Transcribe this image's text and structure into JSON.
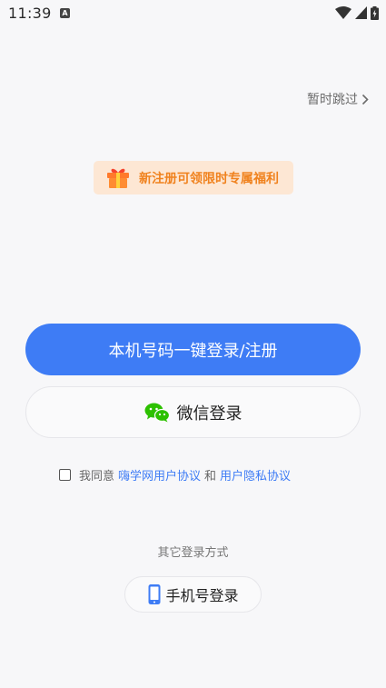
{
  "status_bar": {
    "time": "11:39",
    "app_icon_letter": "A",
    "icons": [
      "wifi-icon",
      "signal-icon",
      "battery-charging-icon"
    ]
  },
  "skip": {
    "label": "暂时跳过",
    "icon": "chevron-right-icon"
  },
  "promo": {
    "icon": "gift-icon",
    "text": "新注册可领限时专属福利"
  },
  "primary_login": {
    "label": "本机号码一键登录/注册"
  },
  "wechat_login": {
    "icon": "wechat-icon",
    "label": "微信登录"
  },
  "agreement": {
    "checked": false,
    "prefix": "我同意",
    "user_agreement": "嗨学网用户协议",
    "and": "和",
    "privacy_policy": "用户隐私协议"
  },
  "other_login": {
    "title": "其它登录方式",
    "phone_login": {
      "icon": "mobile-phone-icon",
      "label": "手机号登录"
    }
  },
  "colors": {
    "accent": "#3e7cf5",
    "promo_bg": "#fde7d4",
    "promo_text": "#f0821e",
    "wechat_green": "#2dc100",
    "background": "#f7f7f9"
  }
}
